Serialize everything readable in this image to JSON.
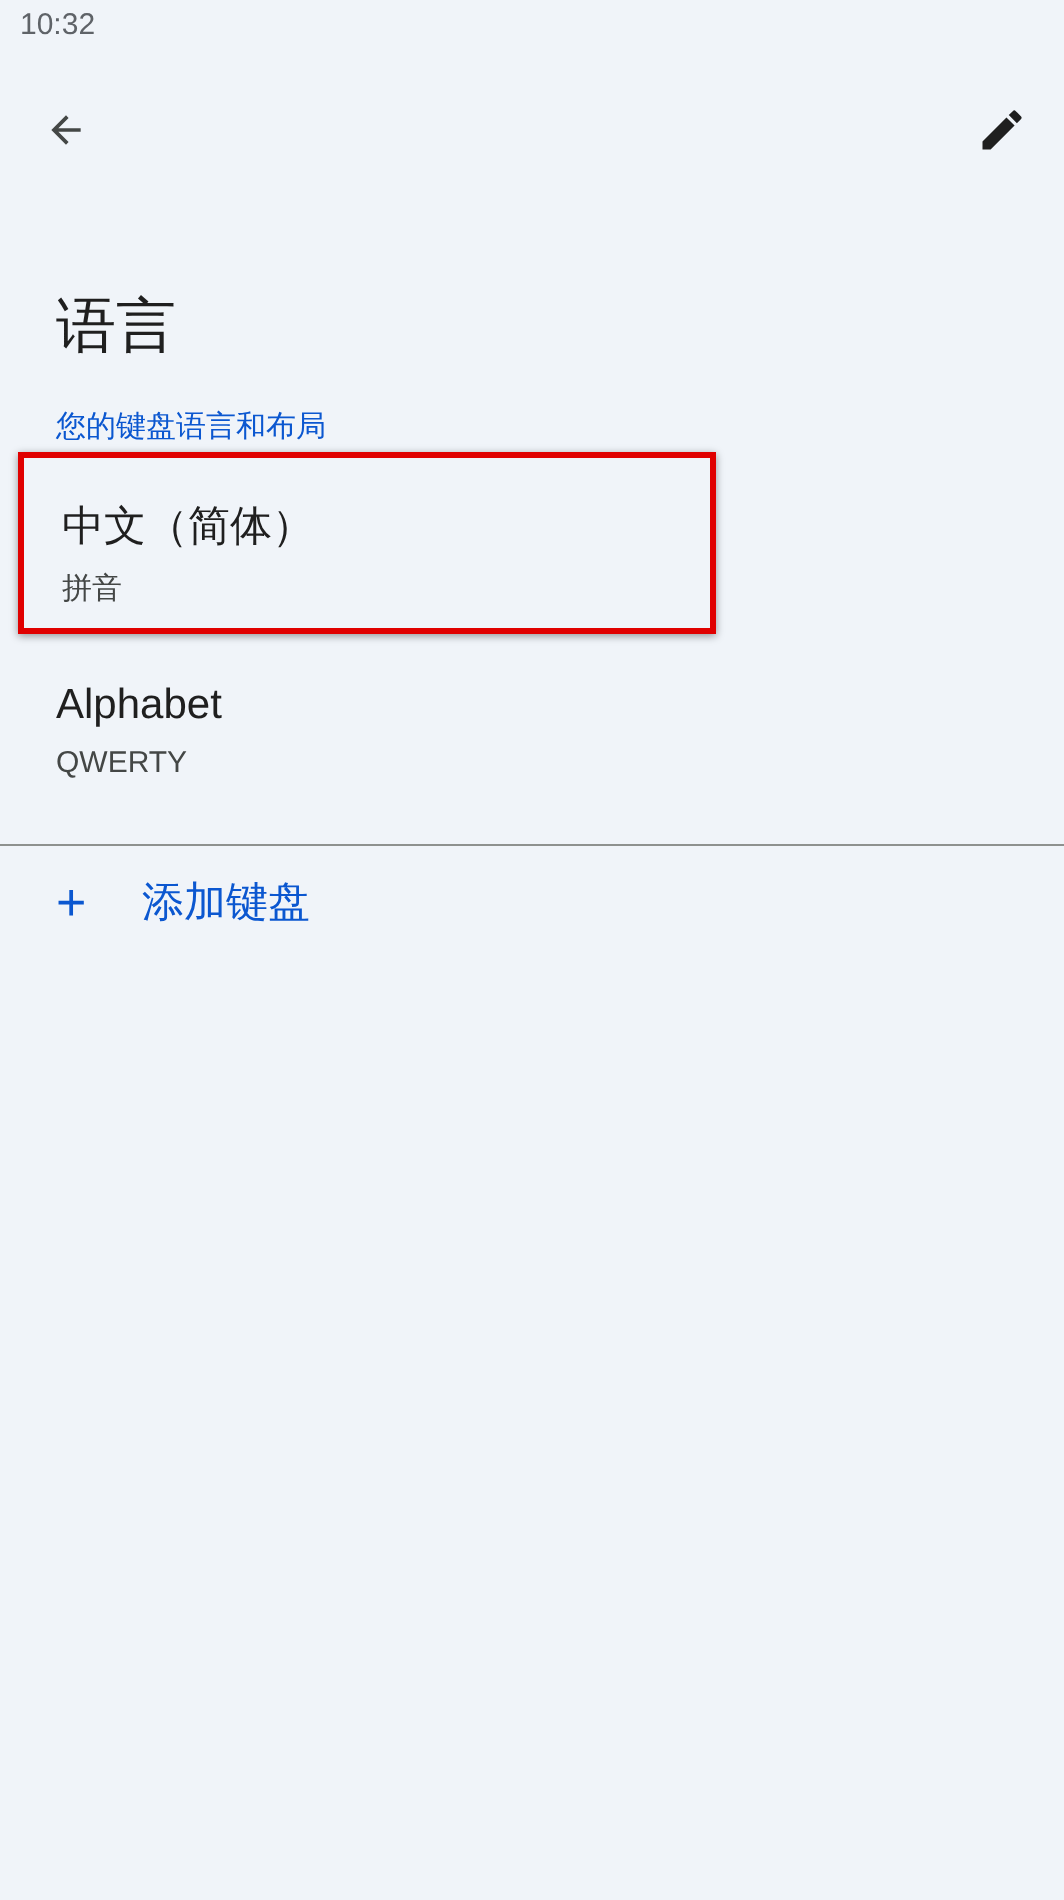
{
  "status_bar": {
    "time": "10:32"
  },
  "title": "语言",
  "section_header": "您的键盘语言和布局",
  "keyboards": [
    {
      "name": "中文（简体）",
      "layout": "拼音",
      "highlighted": true
    },
    {
      "name": "Alphabet",
      "layout": "QWERTY",
      "highlighted": false
    }
  ],
  "add_action": {
    "icon": "+",
    "label": "添加键盘"
  }
}
